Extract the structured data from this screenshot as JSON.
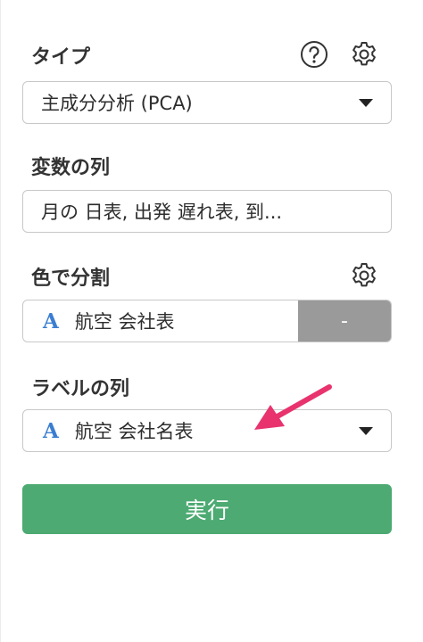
{
  "type_section": {
    "label": "タイプ",
    "help_icon": "question-circle-icon",
    "settings_icon": "gear-icon",
    "selected": "主成分分析 (PCA)"
  },
  "variables_section": {
    "label": "変数の列",
    "value": "月の 日表, 出発 遅れ表, 到..."
  },
  "color_section": {
    "label": "色で分割",
    "settings_icon": "gear-icon",
    "column_type_glyph": "A",
    "column": "航空 会社表",
    "clear_button": "-"
  },
  "label_section": {
    "label": "ラベルの列",
    "column_type_glyph": "A",
    "selected": "航空 会社名表"
  },
  "run_button": "実行",
  "colors": {
    "accent_green": "#4caa72",
    "column_type_blue": "#3b7ed1",
    "annotation_pink": "#e8336e",
    "clear_button_gray": "#9a9a9a"
  }
}
